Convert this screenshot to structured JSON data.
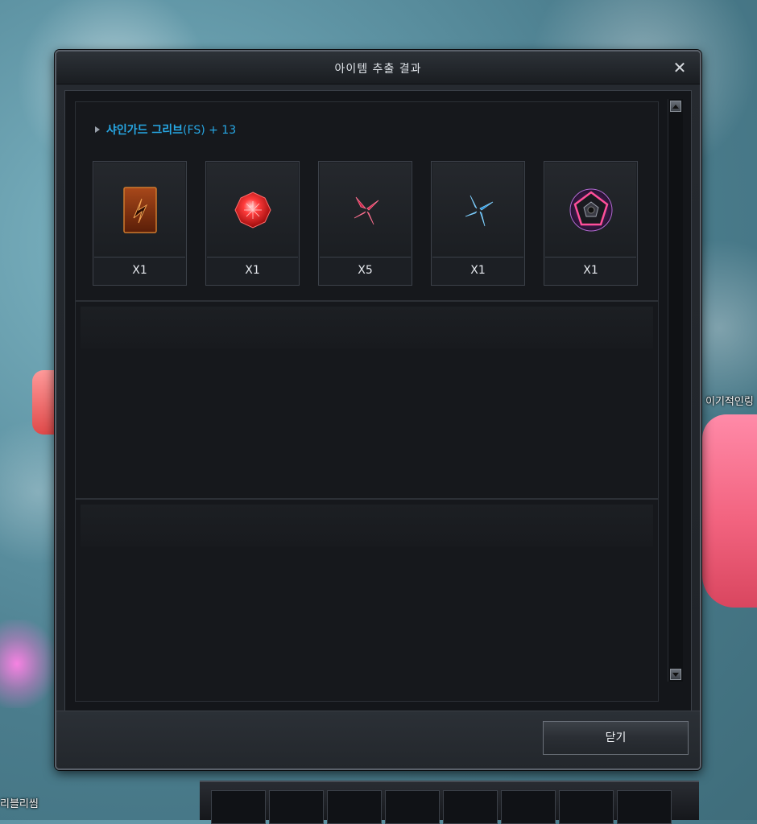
{
  "background": {
    "nameplates": {
      "right": "이기적인링",
      "left": "리블리씸"
    }
  },
  "dialog": {
    "title": "아이템 추출 결과",
    "entries": [
      {
        "name": "샤인가드 그리브",
        "suffix": "(FS) + 13",
        "items": [
          {
            "icon": "rune-card-icon",
            "qty": "X1"
          },
          {
            "icon": "red-gem-icon",
            "qty": "X1"
          },
          {
            "icon": "red-crystal-shard-icon",
            "qty": "X5"
          },
          {
            "icon": "blue-crystal-shard-icon",
            "qty": "X1"
          },
          {
            "icon": "pentagon-seal-icon",
            "qty": "X1"
          }
        ]
      }
    ],
    "close_button_label": "닫기"
  },
  "colors": {
    "item_name": "#27a7e4",
    "dialog_bg": "#1f2328",
    "frame_border": "#5a6069"
  }
}
